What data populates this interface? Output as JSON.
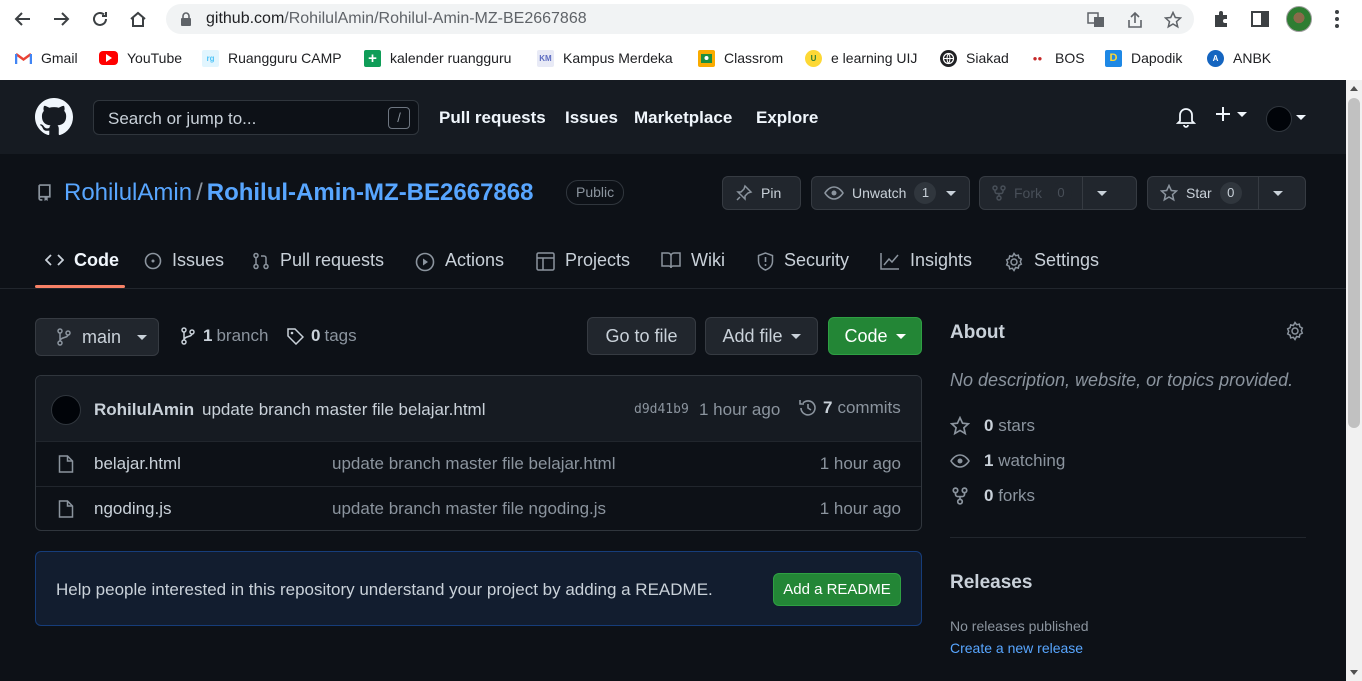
{
  "browser": {
    "url_host": "github.com",
    "url_path": "/RohilulAmin/Rohilul-Amin-MZ-BE2667868",
    "bookmarks": [
      {
        "label": "Gmail",
        "icon": "gmail-icon",
        "color": "#ea4335"
      },
      {
        "label": "YouTube",
        "icon": "youtube-icon",
        "color": "#ff0000"
      },
      {
        "label": "Ruangguru CAMP",
        "icon": "ruangguru-icon",
        "color": "#4fc3f7"
      },
      {
        "label": "kalender ruangguru",
        "icon": "plus-square-icon",
        "color": "#0f9d58"
      },
      {
        "label": "Kampus Merdeka",
        "icon": "kampus-merdeka-icon",
        "color": "#5c6bc0"
      },
      {
        "label": "Classrom",
        "icon": "classroom-icon",
        "color": "#f9ab00"
      },
      {
        "label": "e learning UIJ",
        "icon": "uij-icon",
        "color": "#2e7d32"
      },
      {
        "label": "Siakad",
        "icon": "globe-icon",
        "color": "#202124"
      },
      {
        "label": "BOS",
        "icon": "bos-icon",
        "color": "#c62828"
      },
      {
        "label": "Dapodik",
        "icon": "dapodik-icon",
        "color": "#1e88e5"
      },
      {
        "label": "ANBK",
        "icon": "anbk-icon",
        "color": "#1565c0"
      }
    ]
  },
  "header": {
    "search_placeholder": "Search or jump to...",
    "search_shortcut": "/",
    "nav": [
      "Pull requests",
      "Issues",
      "Marketplace",
      "Explore"
    ]
  },
  "repo": {
    "owner": "RohilulAmin",
    "separator": "/",
    "name": "Rohilul-Amin-MZ-BE2667868",
    "visibility": "Public",
    "pin_label": "Pin",
    "watch_label": "Unwatch",
    "watch_count": "1",
    "fork_label": "Fork",
    "fork_count": "0",
    "star_label": "Star",
    "star_count": "0"
  },
  "tabs": [
    {
      "label": "Code",
      "icon": "code-icon"
    },
    {
      "label": "Issues",
      "icon": "issue-icon"
    },
    {
      "label": "Pull requests",
      "icon": "pull-request-icon"
    },
    {
      "label": "Actions",
      "icon": "play-icon"
    },
    {
      "label": "Projects",
      "icon": "table-icon"
    },
    {
      "label": "Wiki",
      "icon": "book-icon"
    },
    {
      "label": "Security",
      "icon": "shield-icon"
    },
    {
      "label": "Insights",
      "icon": "graph-icon"
    },
    {
      "label": "Settings",
      "icon": "gear-icon"
    }
  ],
  "toolbar": {
    "branch": "main",
    "branch_count": "1",
    "branch_word": "branch",
    "tag_count": "0",
    "tag_word": "tags",
    "go_to_file": "Go to file",
    "add_file": "Add file",
    "code": "Code"
  },
  "commit": {
    "author": "RohilulAmin",
    "message": "update branch master file belajar.html",
    "sha": "d9d41b9",
    "time": "1 hour ago",
    "count": "7",
    "count_word": "commits"
  },
  "files": [
    {
      "name": "belajar.html",
      "message": "update branch master file belajar.html",
      "time": "1 hour ago"
    },
    {
      "name": "ngoding.js",
      "message": "update branch master file ngoding.js",
      "time": "1 hour ago"
    }
  ],
  "readme": {
    "text": "Help people interested in this repository understand your project by adding a README.",
    "button": "Add a README"
  },
  "about": {
    "title": "About",
    "description": "No description, website, or topics provided.",
    "stars_count": "0",
    "stars_word": "stars",
    "watching_count": "1",
    "watching_word": "watching",
    "forks_count": "0",
    "forks_word": "forks"
  },
  "releases": {
    "title": "Releases",
    "none": "No releases published",
    "create_link": "Create a new release"
  }
}
